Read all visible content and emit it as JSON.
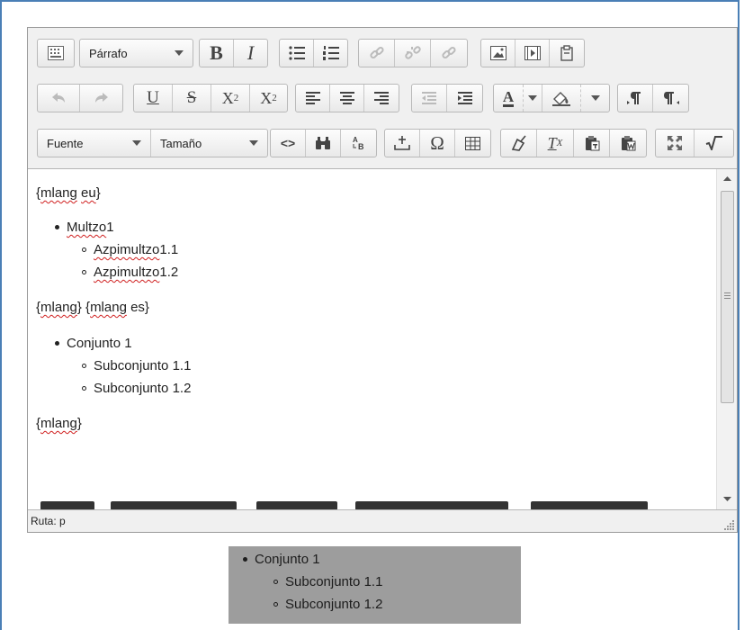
{
  "toolbar": {
    "format_select": "Párrafo",
    "font_select": "Fuente",
    "size_select": "Tamaño",
    "bold": "B",
    "italic": "I",
    "underline": "U",
    "strike": "S",
    "subscript": "X",
    "subscript_sub": "2",
    "superscript": "X",
    "superscript_sup": "2",
    "omega": "Ω",
    "clear_format": "T",
    "clear_format_sub": "X",
    "font_color": "A",
    "code": "<>"
  },
  "content": {
    "line1_a": "{",
    "line1_b": "mlang",
    "line1_c": " ",
    "line1_d": "eu",
    "line1_e": "}",
    "list1_item": "Multzo",
    "list1_item_num": " 1",
    "list1_sub1": "Azpimultzo",
    "list1_sub1_num": " 1.1",
    "list1_sub2": "Azpimultzo",
    "list1_sub2_num": " 1.2",
    "line2_a": "{",
    "line2_b": "mlang",
    "line2_c": "} {",
    "line2_d": "mlang",
    "line2_e": " es}",
    "list2_item": "Conjunto 1",
    "list2_sub1": "Subconjunto 1.1",
    "list2_sub2": "Subconjunto 1.2",
    "line3_a": "{",
    "line3_b": "mlang",
    "line3_c": "}"
  },
  "status": {
    "path": "Ruta: p"
  },
  "preview": {
    "item": "Conjunto 1",
    "sub1": "Subconjunto 1.1",
    "sub2": "Subconjunto 1.2"
  },
  "colors": {
    "frame_border": "#4a7fb6",
    "spell_underline": "#d02020",
    "preview_bg": "#9d9d9d"
  }
}
